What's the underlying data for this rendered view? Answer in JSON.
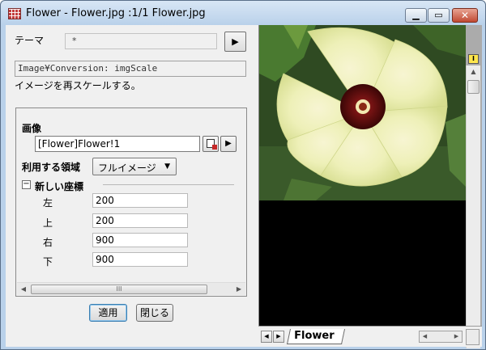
{
  "window": {
    "title": "Flower - Flower.jpg :1/1 Flower.jpg",
    "min_glyph": "▁",
    "max_glyph": "▭",
    "close_glyph": "✕"
  },
  "dialog": {
    "theme_label": "テーマ",
    "theme_value": "*",
    "theme_arrow": "▶",
    "description_code": "Image¥Conversion: imgScale",
    "description_text": "イメージを再スケールする。",
    "image_label": "画像",
    "image_value": "[Flower]Flower!1",
    "image_arrow": "▶",
    "region_label": "利用する領域",
    "region_value": "フルイメージ",
    "region_caret": "▼",
    "coords_toggle": "−",
    "coords_title": "新しい座標",
    "coords": [
      {
        "label": "左",
        "value": "200"
      },
      {
        "label": "上",
        "value": "200"
      },
      {
        "label": "右",
        "value": "900"
      },
      {
        "label": "下",
        "value": "900"
      }
    ],
    "hscroll_left": "◀",
    "hscroll_right": "▶",
    "hscroll_grip": "III",
    "apply_label": "適用",
    "close_label": "閉じる"
  },
  "image_view": {
    "badge": "I",
    "sheet_tab": "Flower",
    "vscroll_up": "▲",
    "vscroll_down": "▼",
    "tabnav_prev": "◀",
    "tabnav_next": "▶",
    "tab_hs_left": "◀",
    "tab_hs_right": "▶"
  },
  "colors": {
    "titlebar": "#b9d1ea",
    "canvas_bg": "#000000",
    "petal": "#eef0b8",
    "flower_center": "#5a0a0a",
    "foliage": "#3f6a2a"
  }
}
